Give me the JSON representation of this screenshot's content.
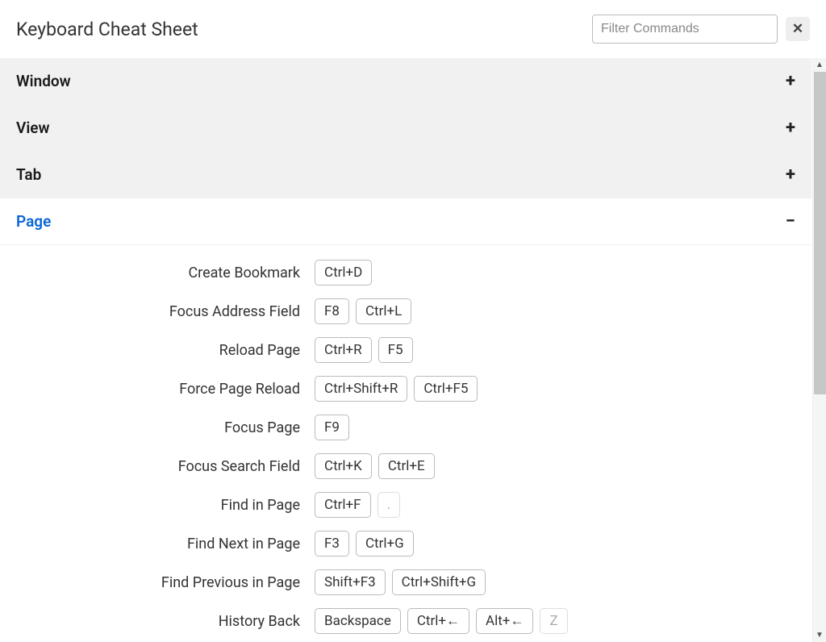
{
  "header": {
    "title": "Keyboard Cheat Sheet",
    "filter_placeholder": "Filter Commands",
    "close_icon": "✕"
  },
  "sections": [
    {
      "title": "Window",
      "expanded": false
    },
    {
      "title": "View",
      "expanded": false
    },
    {
      "title": "Tab",
      "expanded": false
    },
    {
      "title": "Page",
      "expanded": true,
      "commands": [
        {
          "label": "Create Bookmark",
          "keys": [
            "Ctrl+D"
          ]
        },
        {
          "label": "Focus Address Field",
          "keys": [
            "F8",
            "Ctrl+L"
          ]
        },
        {
          "label": "Reload Page",
          "keys": [
            "Ctrl+R",
            "F5"
          ]
        },
        {
          "label": "Force Page Reload",
          "keys": [
            "Ctrl+Shift+R",
            "Ctrl+F5"
          ]
        },
        {
          "label": "Focus Page",
          "keys": [
            "F9"
          ]
        },
        {
          "label": "Focus Search Field",
          "keys": [
            "Ctrl+K",
            "Ctrl+E"
          ]
        },
        {
          "label": "Find in Page",
          "keys": [
            "Ctrl+F",
            "."
          ],
          "dim": [
            1
          ]
        },
        {
          "label": "Find Next in Page",
          "keys": [
            "F3",
            "Ctrl+G"
          ]
        },
        {
          "label": "Find Previous in Page",
          "keys": [
            "Shift+F3",
            "Ctrl+Shift+G"
          ]
        },
        {
          "label": "History Back",
          "keys": [
            "Backspace",
            "Ctrl+←",
            "Alt+←",
            "Z"
          ],
          "dim": [
            3
          ]
        }
      ]
    }
  ],
  "icons": {
    "plus": "+",
    "minus": "−"
  }
}
